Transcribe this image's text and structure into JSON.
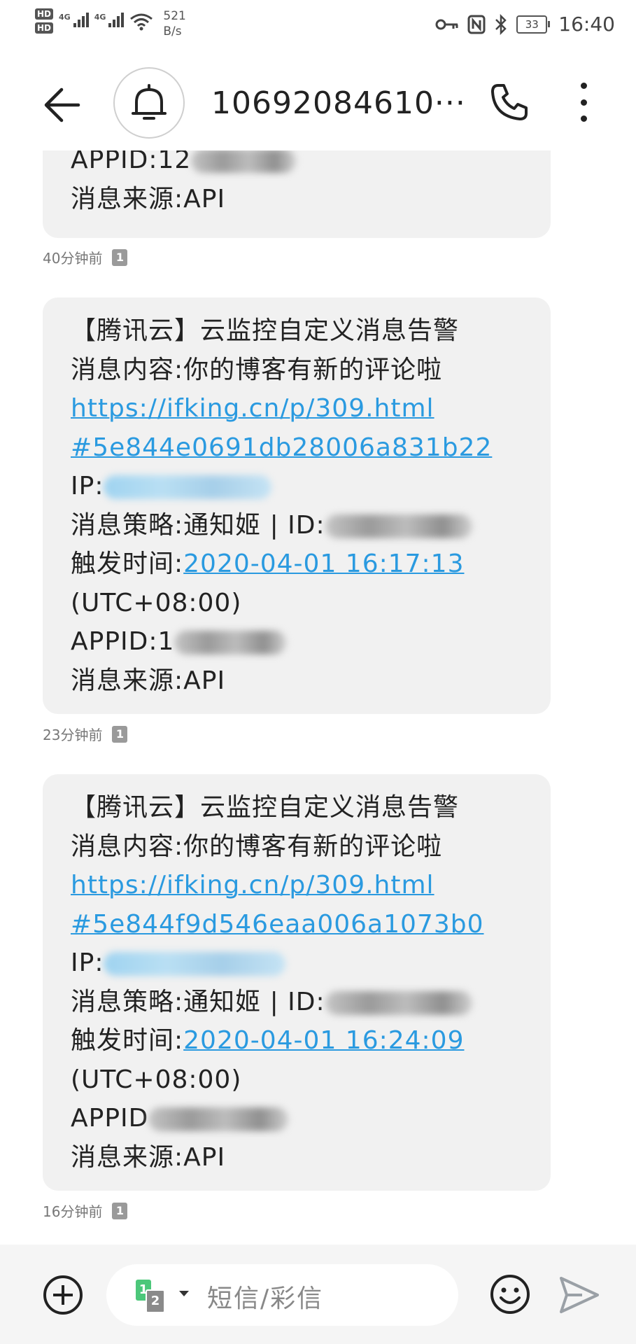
{
  "status_bar": {
    "hd1": "HD",
    "hd2": "HD",
    "sig1_label": "4G",
    "sig2_label": "4G",
    "speed_value": "521",
    "speed_unit": "B/s",
    "battery": "33",
    "time": "16:40"
  },
  "header": {
    "title": "10692084610···"
  },
  "messages": [
    {
      "appid_label": "APPID:",
      "appid_visible": "12",
      "source": "消息来源:API",
      "time_ago": "40分钟前",
      "sim": "1"
    },
    {
      "title": "【腾讯云】云监控自定义消息告警",
      "content": "消息内容:你的博客有新的评论啦",
      "link_line1": "https://ifking.cn/p/309.html",
      "link_line2": "#5e844e0691db28006a831b22",
      "ip_label": "IP:",
      "policy_label": "消息策略:通知姬 | ID:",
      "trigger_label": "触发时间:",
      "trigger_time": "2020-04-01 16:17:13",
      "timezone": "(UTC+08:00)",
      "appid_label": "APPID:",
      "appid_visible": "1",
      "source": "消息来源:API",
      "time_ago": "23分钟前",
      "sim": "1"
    },
    {
      "title": "【腾讯云】云监控自定义消息告警",
      "content": "消息内容:你的博客有新的评论啦",
      "link_line1": "https://ifking.cn/p/309.html",
      "link_line2": "#5e844f9d546eaa006a1073b0",
      "ip_label": "IP:",
      "policy_label": "消息策略:通知姬 | ID:",
      "trigger_label": "触发时间:",
      "trigger_time": "2020-04-01 16:24:09",
      "timezone": "(UTC+08:00)",
      "appid_label": "APPID",
      "source": "消息来源:API",
      "time_ago": "16分钟前",
      "sim": "1"
    }
  ],
  "composer": {
    "sim1": "1",
    "sim2": "2",
    "placeholder": "短信/彩信"
  }
}
